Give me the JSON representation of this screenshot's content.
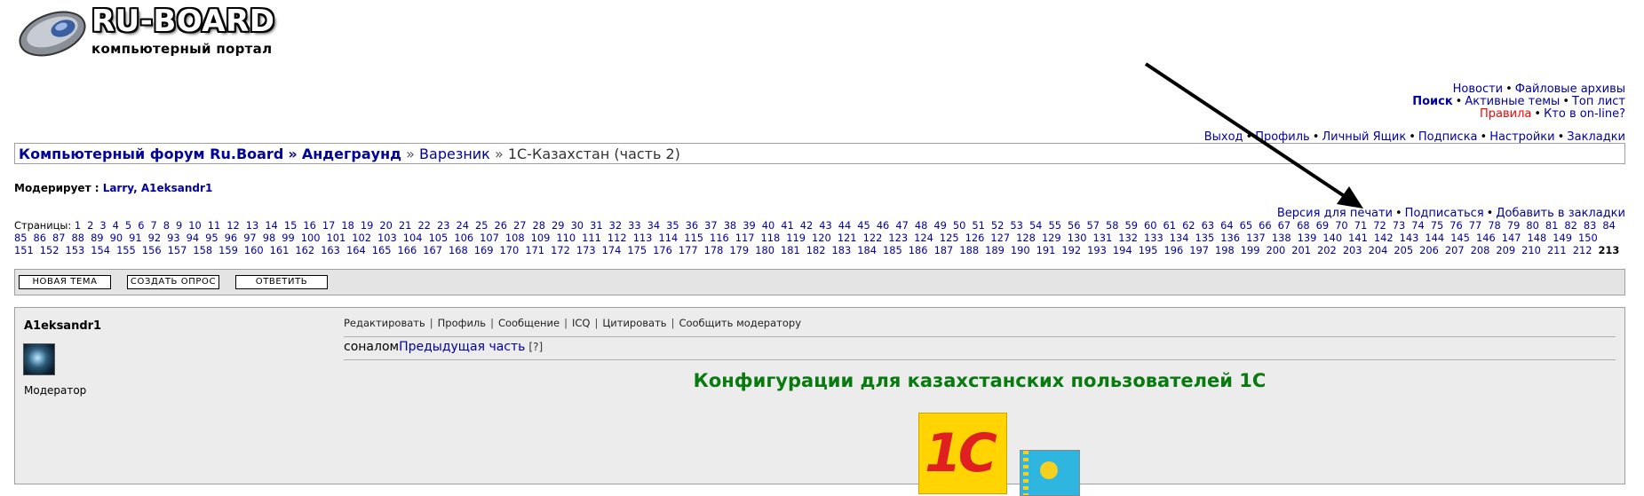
{
  "logo": {
    "title": "RU-BOARD",
    "subtitle": "компьютерный портал"
  },
  "top_nav": {
    "row1": [
      "Новости",
      "Файловые архивы"
    ],
    "row2": [
      "Поиск",
      "Активные темы",
      "Топ лист"
    ],
    "row3": [
      "Правила",
      "Кто в on-line?"
    ],
    "row4": [
      "Выход",
      "Профиль",
      "Личный Ящик",
      "Подписка",
      "Настройки",
      "Закладки"
    ],
    "separator": "•"
  },
  "breadcrumb": {
    "forum": "Компьютерный форум Ru.Board",
    "sep": "»",
    "section": "Андеграунд",
    "subsection": "Варезник",
    "topic": "1С-Казахстан (часть 2)"
  },
  "moderators": {
    "label": "Модерирует :",
    "names": "Larry, A1eksandr1"
  },
  "topic_actions": [
    "Версия для печати",
    "Подписаться",
    "Добавить в закладки"
  ],
  "pagination": {
    "label": "Страницы:",
    "last_page": 213,
    "current": 213
  },
  "toolbar": {
    "new_topic": "НОВАЯ ТЕМА",
    "new_poll": "СОЗДАТЬ ОПРОС",
    "reply": "ОТВЕТИТЬ"
  },
  "post": {
    "author": "A1eksandr1",
    "role": "Модератор",
    "actions": [
      "Редактировать",
      "Профиль",
      "Сообщение",
      "ICQ",
      "Цитировать",
      "Сообщить модератору"
    ],
    "action_sep": "|",
    "text_prefix": "соналом",
    "prev_link": "Предыдущая часть",
    "hint": "[?]",
    "heading": "Конфигурации для казахстанских пользователей 1С",
    "logo_text": "1С"
  },
  "colors": {
    "link": "#00009c",
    "heading": "#087a10",
    "warning": "#ff0000"
  }
}
